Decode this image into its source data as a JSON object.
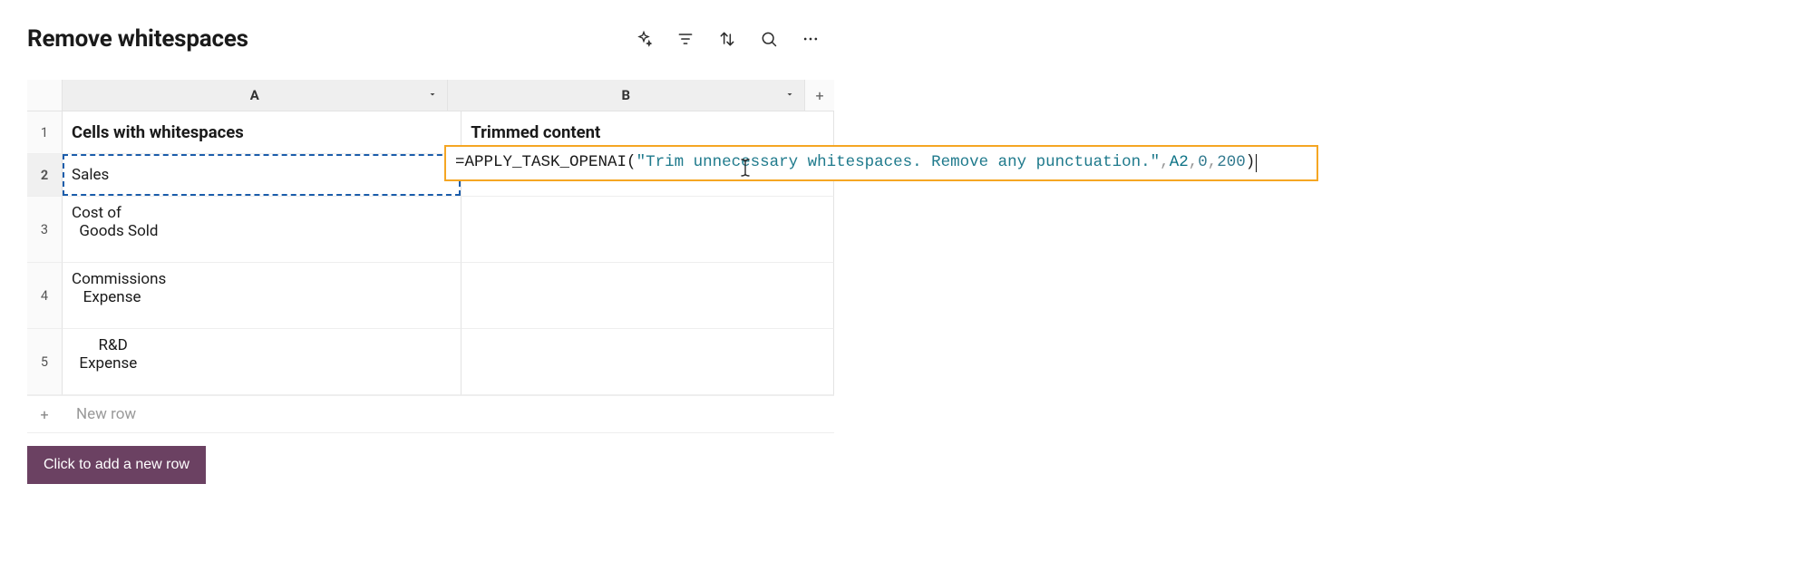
{
  "title": "Remove whitespaces",
  "toolbar": {
    "icons": {
      "sparkle": "sparkle-icon",
      "filter": "filter-icon",
      "sort": "sort-icon",
      "search": "search-icon",
      "more": "more-icon"
    }
  },
  "columns": {
    "a": {
      "letter": "A",
      "name": "Cells with whitespaces"
    },
    "b": {
      "letter": "B",
      "name": "Trimmed content"
    }
  },
  "rows": [
    {
      "n": "1",
      "a": "Cells with whitespaces",
      "b": "Trimmed content",
      "header": true
    },
    {
      "n": "2",
      "a": "Sales",
      "b_formula": true
    },
    {
      "n": "3",
      "a": "Cost of\n  Goods Sold",
      "b": ""
    },
    {
      "n": "4",
      "a": "Commissions\n   Expense",
      "b": ""
    },
    {
      "n": "5",
      "a": "       R&D\n  Expense",
      "b": ""
    }
  ],
  "formula": {
    "fn": "APPLY_TASK_OPENAI",
    "string_arg": "\"Trim unnecessary whitespaces. Remove any punctuation.\"",
    "ref": "A2",
    "arg0": "0",
    "arg1": "200",
    "raw": "=APPLY_TASK_OPENAI(\"Trim unnecessary whitespaces. Remove any punctuation.\",A2,0,200)"
  },
  "newrow_label": "New row",
  "cta_label": "Click to add a new row"
}
